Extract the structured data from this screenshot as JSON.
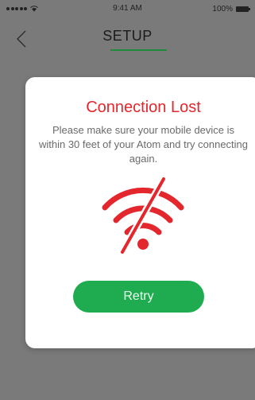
{
  "status_bar": {
    "time": "9:41 AM",
    "battery": "100%"
  },
  "nav": {
    "title": "SETUP",
    "back_icon": "chevron-left-icon"
  },
  "modal": {
    "title": "Connection Lost",
    "message": "Please make sure your mobile device is within 30 feet of your Atom and try connecting again.",
    "icon": "wifi-off-icon",
    "retry_label": "Retry"
  },
  "colors": {
    "accent_green": "#1fab4f",
    "error_red": "#e4262d",
    "underline_green": "#1e8b3a"
  }
}
